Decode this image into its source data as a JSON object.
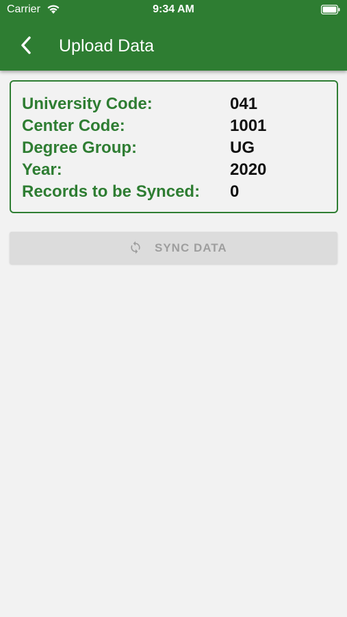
{
  "status_bar": {
    "carrier": "Carrier",
    "time": "9:34 AM",
    "icons": [
      "wifi-icon",
      "battery-icon"
    ]
  },
  "nav": {
    "title": "Upload Data",
    "back_icon": "chevron-left-icon"
  },
  "info": {
    "rows": [
      {
        "label": "University Code:",
        "value": "041"
      },
      {
        "label": "Center Code:",
        "value": "1001"
      },
      {
        "label": "Degree Group:",
        "value": "UG"
      },
      {
        "label": "Year:",
        "value": "2020"
      },
      {
        "label": "Records to be Synced:",
        "value": "0"
      }
    ]
  },
  "sync_button": {
    "label": "SYNC DATA",
    "icon": "sync-icon",
    "enabled": false
  },
  "colors": {
    "primary": "#2e7d32",
    "background": "#f2f2f2",
    "button_disabled": "#dcdcdc",
    "button_text_disabled": "#9e9e9e"
  }
}
